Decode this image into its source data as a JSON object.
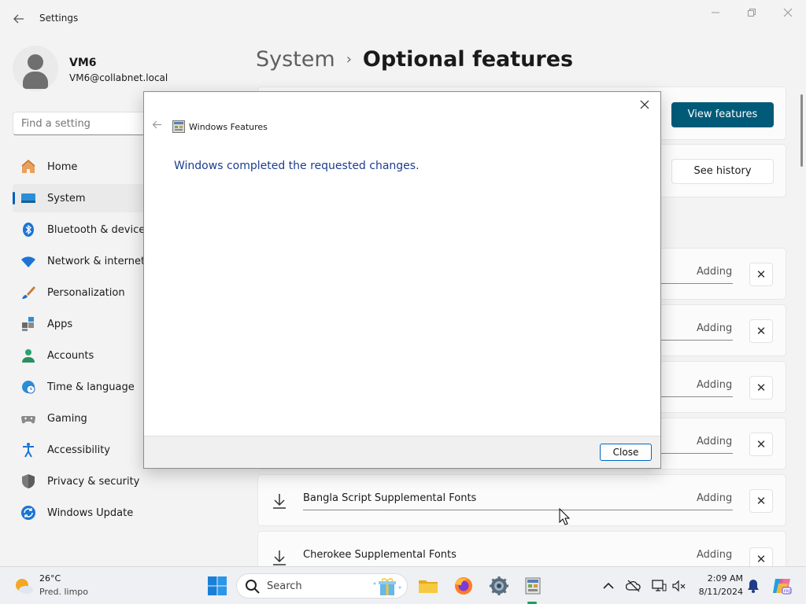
{
  "settings": {
    "app_title": "Settings",
    "user": {
      "name": "VM6",
      "email": "VM6@collabnet.local"
    },
    "search_placeholder": "Find a setting",
    "nav": [
      {
        "label": "Home",
        "icon": "home-icon"
      },
      {
        "label": "System",
        "icon": "system-icon",
        "active": true
      },
      {
        "label": "Bluetooth & devices",
        "icon": "bluetooth-icon"
      },
      {
        "label": "Network & internet",
        "icon": "wifi-icon"
      },
      {
        "label": "Personalization",
        "icon": "brush-icon"
      },
      {
        "label": "Apps",
        "icon": "apps-icon"
      },
      {
        "label": "Accounts",
        "icon": "accounts-icon"
      },
      {
        "label": "Time & language",
        "icon": "globe-clock-icon"
      },
      {
        "label": "Gaming",
        "icon": "gamepad-icon"
      },
      {
        "label": "Accessibility",
        "icon": "accessibility-icon"
      },
      {
        "label": "Privacy & security",
        "icon": "shield-icon"
      },
      {
        "label": "Windows Update",
        "icon": "update-icon"
      }
    ],
    "breadcrumb": {
      "parent": "System",
      "separator": "›",
      "current": "Optional features"
    },
    "view_features_label": "View features",
    "see_history_label": "See history",
    "feature_rows": [
      {
        "name": "",
        "status": "Adding"
      },
      {
        "name": "",
        "status": "Adding"
      },
      {
        "name": "",
        "status": "Adding"
      },
      {
        "name": "",
        "status": "Adding"
      },
      {
        "name": "Bangla Script Supplemental Fonts",
        "status": "Adding"
      },
      {
        "name": "Cherokee Supplemental Fonts",
        "status": "Adding"
      }
    ]
  },
  "dialog": {
    "app_name": "Windows Features",
    "message": "Windows completed the requested changes.",
    "close_label": "Close"
  },
  "taskbar": {
    "weather": {
      "temp": "26°C",
      "condition": "Pred. limpo"
    },
    "search_label": "Search",
    "clock": {
      "time": "2:09 AM",
      "date": "8/11/2024"
    }
  },
  "colors": {
    "accent": "#005a78",
    "nav_indicator": "#005fb8",
    "dialog_message": "#1c3d8f"
  }
}
